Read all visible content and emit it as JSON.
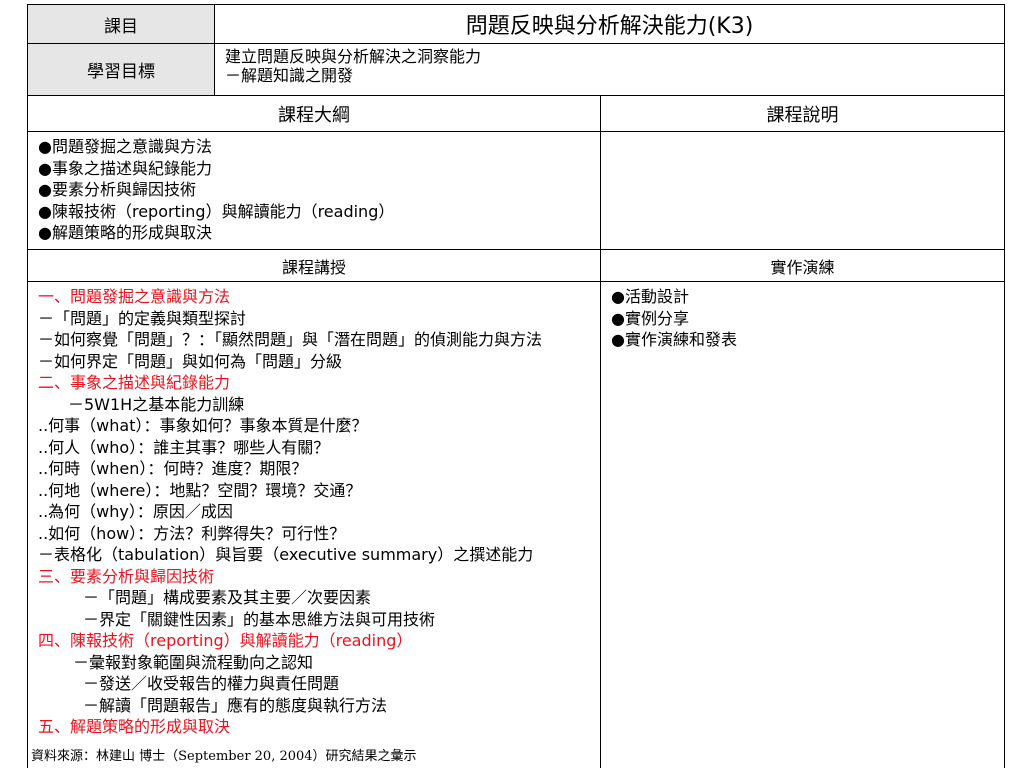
{
  "header": {
    "subject_label": "課目",
    "subject_value": "問題反映與分析解決能力(K3)",
    "goal_label": "學習目標",
    "goal_lines": [
      "建立問題反映與分析解決之洞察能力",
      "－解題知識之開發"
    ]
  },
  "outline": {
    "header": "課程大綱",
    "items": [
      "●問題發掘之意識與方法",
      "●事象之描述與紀錄能力",
      "●要素分析與歸因技術",
      "●陳報技術（reporting）與解讀能力（reading）",
      "●解題策略的形成與取決"
    ]
  },
  "description": {
    "header": "課程說明"
  },
  "lecture": {
    "header": "課程講授",
    "lines": [
      {
        "text": "一、問題發掘之意識與方法",
        "style": "red"
      },
      {
        "text": "－「問題」的定義與類型探討",
        "style": ""
      },
      {
        "text": "－如何察覺「問題」？：「顯然問題」與「潛在問題」的偵測能力與方法",
        "style": ""
      },
      {
        "text": "－如何界定「問題」與如何為「問題」分級",
        "style": ""
      },
      {
        "text": "二、事象之描述與紀錄能力",
        "style": "red"
      },
      {
        "text": "－5W1H之基本能力訓練",
        "style": "ind1"
      },
      {
        "text": "..何事（what）：事象如何？事象本質是什麼？",
        "style": ""
      },
      {
        "text": "..何人（who）：誰主其事？哪些人有關？",
        "style": ""
      },
      {
        "text": "..何時（when）：何時？進度？期限？",
        "style": ""
      },
      {
        "text": "..何地（where）：地點？空間？環境？交通？",
        "style": ""
      },
      {
        "text": "..為何（why）：原因／成因",
        "style": ""
      },
      {
        "text": "..如何（how）：方法？利弊得失？可行性？",
        "style": ""
      },
      {
        "text": "－表格化（tabulation）與旨要（executive summary）之撰述能力",
        "style": ""
      },
      {
        "text": "三、要素分析與歸因技術",
        "style": "red"
      },
      {
        "text": "－「問題」構成要素及其主要／次要因素",
        "style": "ind2"
      },
      {
        "text": "－界定「關鍵性因素」的基本思維方法與可用技術",
        "style": "ind2"
      },
      {
        "text": "四、陳報技術（reporting）與解讀能力（reading）",
        "style": "red"
      },
      {
        "text": "－彙報對象範圍與流程動向之認知",
        "style": "ind3"
      },
      {
        "text": "－發送／收受報告的權力與責任問題",
        "style": "ind2"
      },
      {
        "text": "－解讀「問題報告」應有的態度與執行方法",
        "style": "ind2"
      },
      {
        "text": "五、解題策略的形成與取決",
        "style": "red"
      }
    ]
  },
  "practice": {
    "header": "實作演練",
    "items": [
      "●活動設計",
      "●實例分享",
      "●實作演練和發表"
    ]
  },
  "footer": {
    "source": "資料來源：林建山 博士（September 20, 2004）研究結果之彙示"
  }
}
